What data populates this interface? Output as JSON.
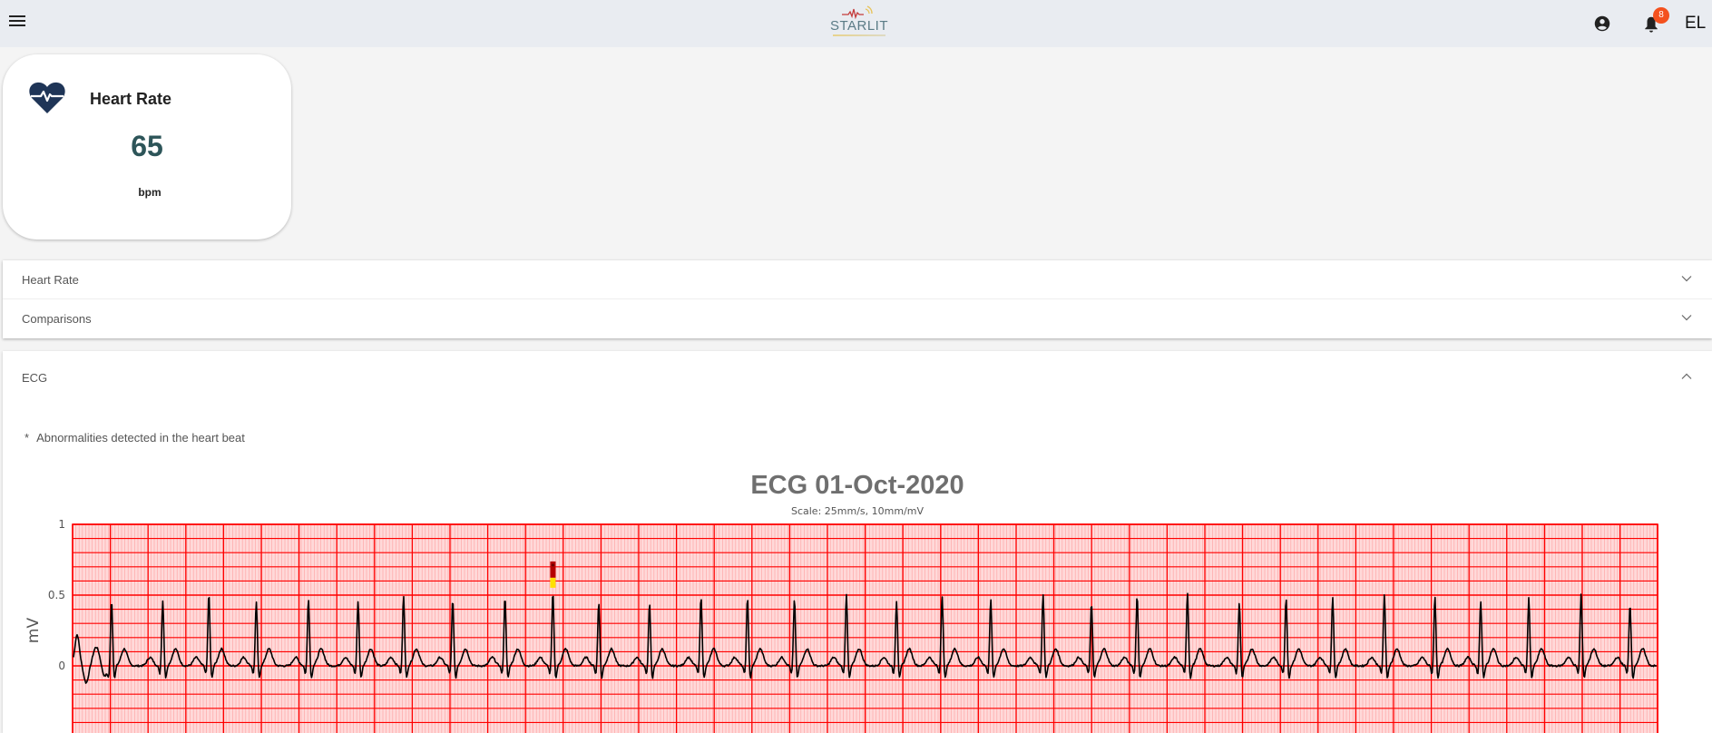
{
  "topbar": {
    "logo_text": "STARLIT",
    "notification_count": "8",
    "user_initials": "EL"
  },
  "heart_rate_card": {
    "title": "Heart Rate",
    "value": "65",
    "unit": "bpm",
    "value_color": "#2d5559",
    "icon_color": "#1f3557"
  },
  "accordion": [
    {
      "label": "Heart Rate",
      "expanded": false
    },
    {
      "label": "Comparisons",
      "expanded": false
    }
  ],
  "ecg_section": {
    "label": "ECG",
    "expanded": true,
    "note_star": "*",
    "note": "Abnormalities detected in the heart beat"
  },
  "chart_data": {
    "type": "line",
    "title": "ECG 01-Oct-2020",
    "subtitle": "Scale: 25mm/s, 10mm/mV",
    "xlabel": "",
    "ylabel": "mV",
    "ylim": [
      -0.5,
      1
    ],
    "yticks": [
      "1",
      "0.5",
      "0"
    ],
    "ytick_values": [
      1,
      0.5,
      0
    ],
    "grid": true,
    "grid_color": "#ff0000",
    "trace_color": "#000000",
    "beats_count": 32,
    "r_peaks_mV": [
      0.47,
      0.46,
      0.51,
      0.45,
      0.48,
      0.46,
      0.5,
      0.47,
      0.49,
      0.52,
      0.45,
      0.44,
      0.49,
      0.48,
      0.47,
      0.51,
      0.46,
      0.5,
      0.47,
      0.51,
      0.45,
      0.5,
      0.52,
      0.45,
      0.48,
      0.49,
      0.5,
      0.49,
      0.46,
      0.48,
      0.51,
      0.44
    ],
    "t_wave_mV": 0.12,
    "baseline_mV": 0,
    "abnormal_beat_index": 9,
    "abnormal_marker_colors": [
      "#b50000",
      "#ffe000"
    ]
  }
}
